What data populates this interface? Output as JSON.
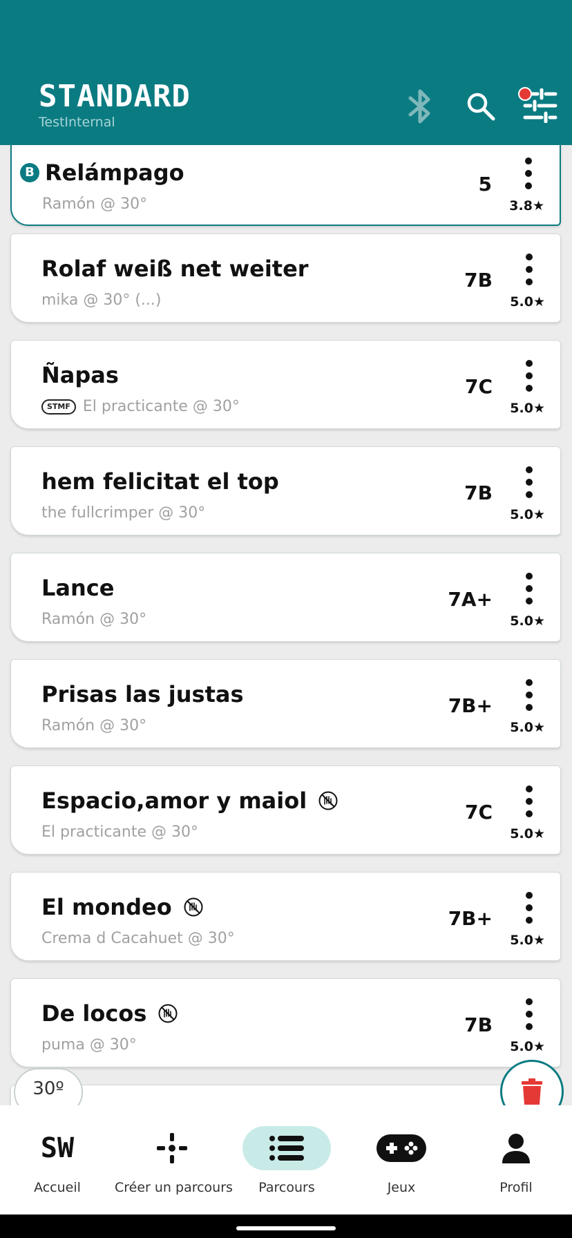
{
  "header": {
    "title": "STANDARD",
    "subtitle": "TestInternal",
    "icons": [
      "bluetooth-icon",
      "search-icon",
      "filter-icon"
    ],
    "colors": {
      "primary": "#0b7b82",
      "notification": "#e53935"
    }
  },
  "routes": [
    {
      "name": "Relámpago",
      "setter": "Ramón @ 30°",
      "grade": "5",
      "rating": "3.8★",
      "selected": true,
      "badge": "B"
    },
    {
      "name": "Rolaf weiß net weiter",
      "setter": "mika @ 30° (...)",
      "grade": "7B",
      "rating": "5.0★"
    },
    {
      "name": "Ñapas",
      "setter": "El practicante  @ 30°",
      "grade": "7C",
      "rating": "5.0★",
      "tag": "STMF"
    },
    {
      "name": "hem felicitat el top",
      "setter": "the fullcrimper @ 30°",
      "grade": "7B",
      "rating": "5.0★"
    },
    {
      "name": "Lance",
      "setter": "Ramón @ 30°",
      "grade": "7A+",
      "rating": "5.0★"
    },
    {
      "name": "Prisas las justas",
      "setter": "Ramón @ 30°",
      "grade": "7B+",
      "rating": "5.0★"
    },
    {
      "name": "Espacio,amor y maiol",
      "setter": "El practicante  @ 30°",
      "grade": "7C",
      "rating": "5.0★",
      "icon": "no-hands-icon"
    },
    {
      "name": "El mondeo",
      "setter": "Crema d Cacahuet @ 30°",
      "grade": "7B+",
      "rating": "5.0★",
      "icon": "no-hands-icon"
    },
    {
      "name": "De locos",
      "setter": "puma @ 30°",
      "grade": "7B",
      "rating": "5.0★",
      "icon": "no-hands-icon"
    }
  ],
  "angle_chip": "30º",
  "nav": [
    {
      "label": "Accueil",
      "icon": "sw-logo-icon",
      "logo": "SW"
    },
    {
      "label": "Créer un parcours",
      "icon": "move-cross-icon"
    },
    {
      "label": "Parcours",
      "icon": "list-icon",
      "active": true
    },
    {
      "label": "Jeux",
      "icon": "gamepad-icon"
    },
    {
      "label": "Profil",
      "icon": "person-icon"
    }
  ]
}
